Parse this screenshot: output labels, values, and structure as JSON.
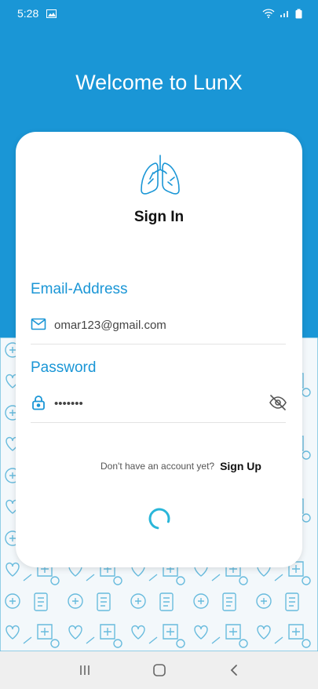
{
  "status_bar": {
    "time": "5:28",
    "icons": [
      "image-icon",
      "wifi-icon",
      "signal-icon",
      "battery-icon"
    ]
  },
  "header": {
    "title": "Welcome to LunX"
  },
  "card": {
    "logo": "lungs-icon",
    "title": "Sign In",
    "email": {
      "label": "Email-Address",
      "value": "omar123@gmail.com",
      "icon": "mail-icon"
    },
    "password": {
      "label": "Password",
      "value": "•••••••",
      "icon": "lock-icon",
      "toggle_icon": "eye-off-icon"
    },
    "signup_prompt": "Don't have an account yet?",
    "signup_link": "Sign Up"
  },
  "nav_bar": {
    "buttons": [
      "recents-icon",
      "home-icon",
      "back-icon"
    ]
  },
  "colors": {
    "primary": "#1a96d6",
    "spinner": "#29b6d9",
    "pattern": "#3aa7d4"
  }
}
